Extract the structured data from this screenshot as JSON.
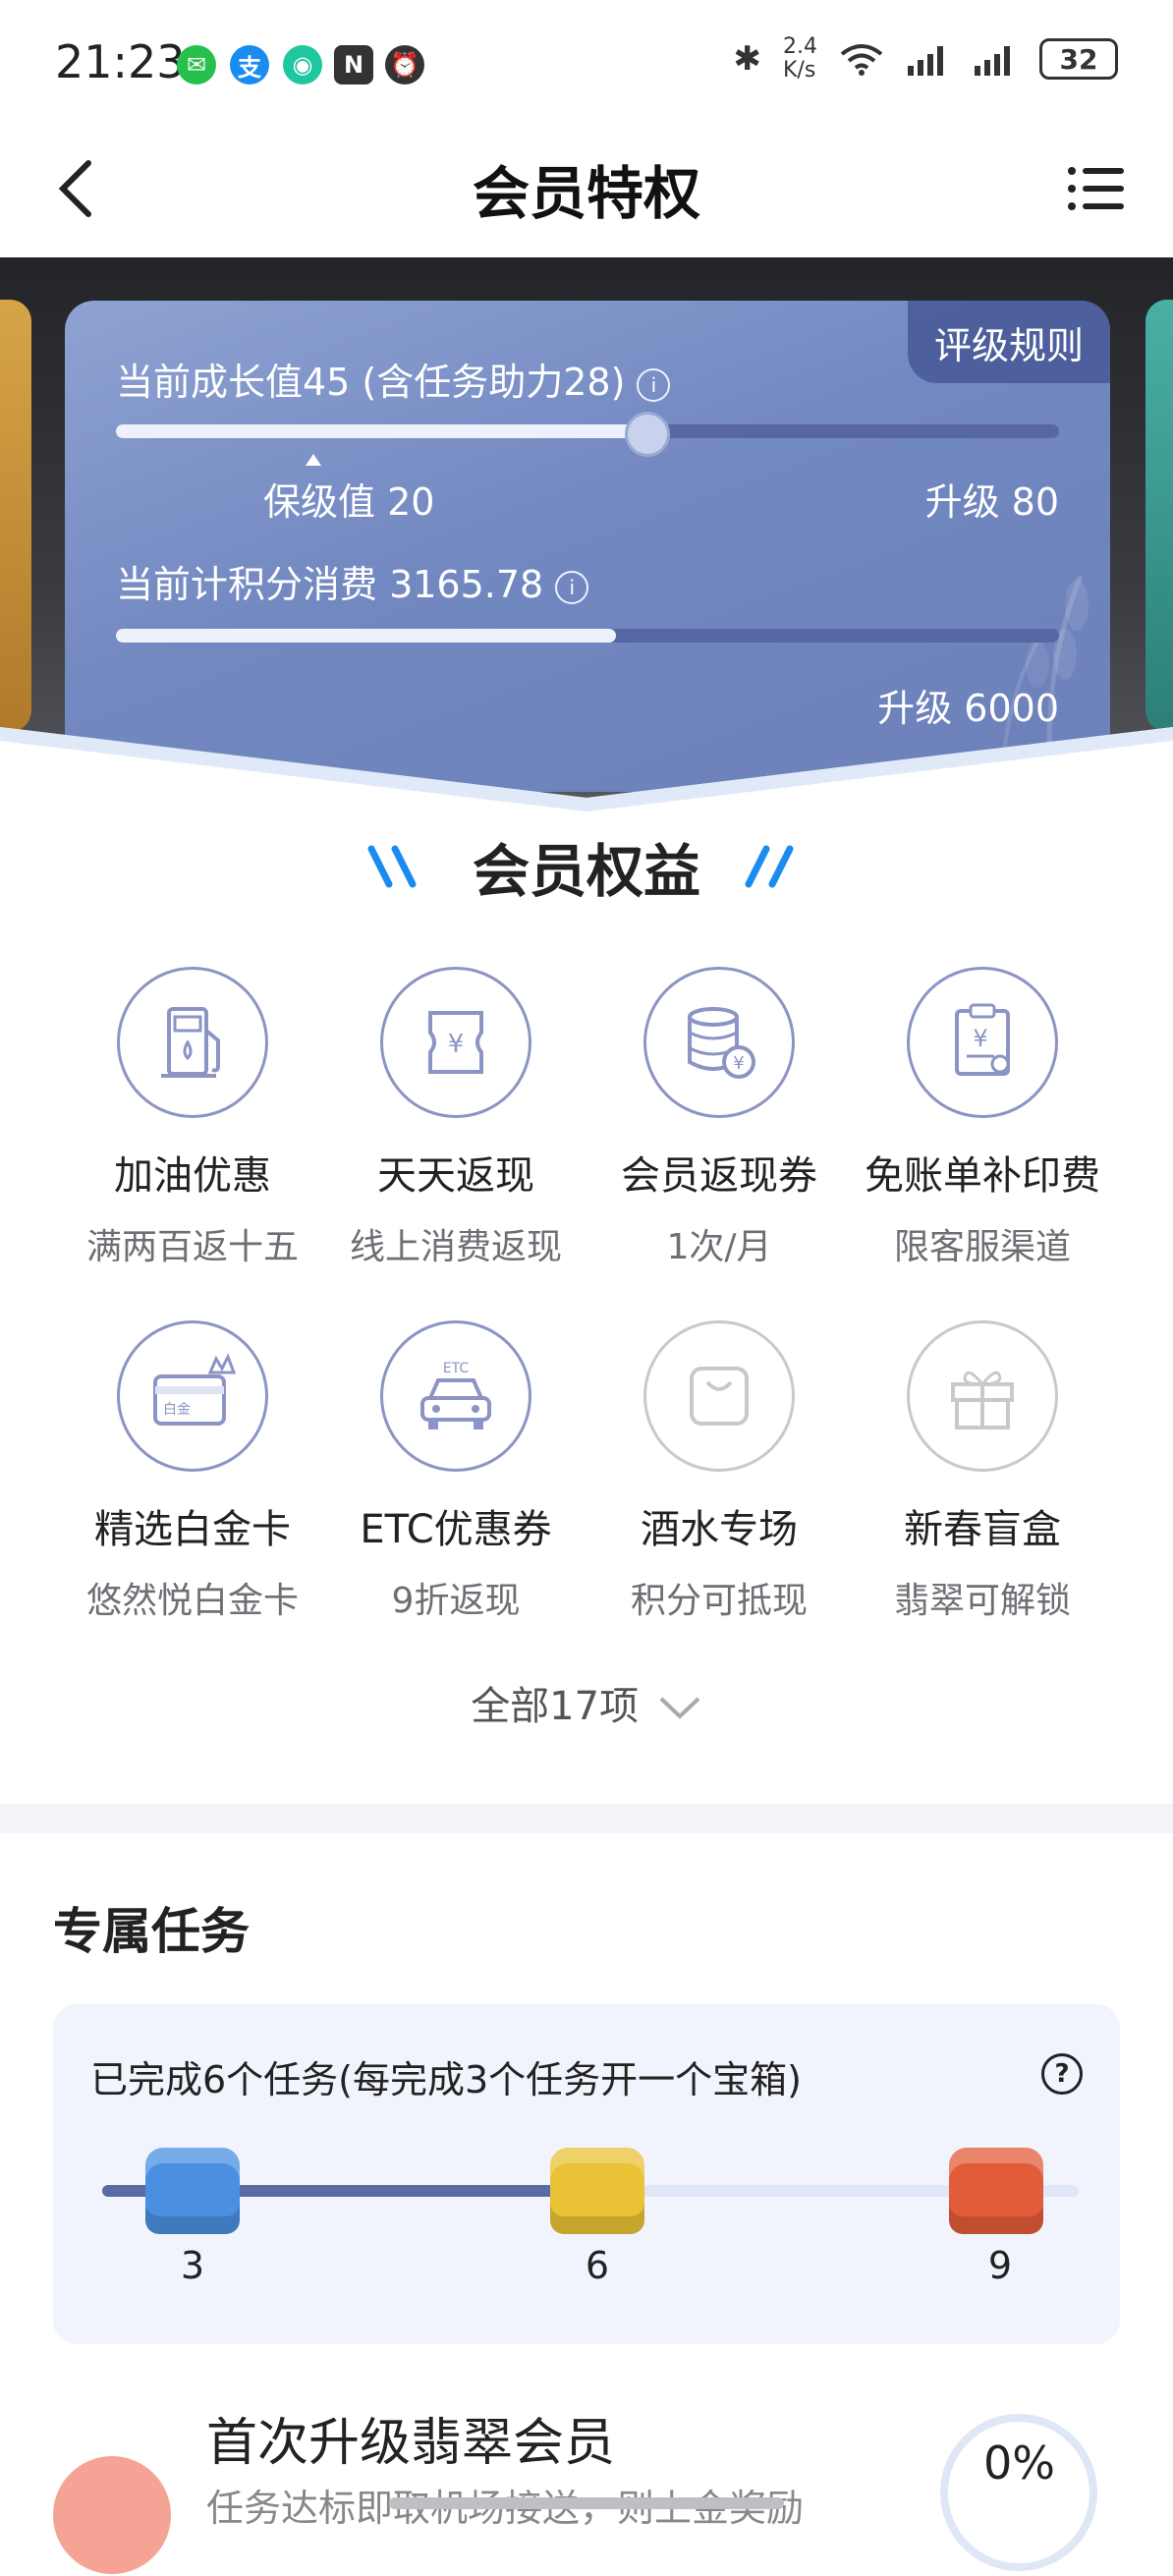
{
  "status_bar": {
    "time": "21:23",
    "net_speed_top": "2.4",
    "net_speed_bottom": "K/s",
    "battery": "32",
    "app_icons": [
      "wechat-icon",
      "alipay-icon",
      "app-icon",
      "nfc-icon",
      "alarm-icon"
    ],
    "system_icons": [
      "bluetooth-icon",
      "wifi-icon",
      "signal-icon",
      "signal-icon"
    ]
  },
  "header": {
    "title": "会员特权"
  },
  "card": {
    "rules_tab": "评级规则",
    "growth_label": "当前成长值45 (含任务助力28)",
    "growth_fraction": 0.56,
    "keep_level": "保级值 20",
    "upgrade_growth": "升级 80",
    "points_label": "当前计积分消费 3165.78",
    "points_fraction": 0.53,
    "upgrade_points": "升级 6000"
  },
  "benefits": {
    "title": "会员权益",
    "items": [
      {
        "name": "加油优惠",
        "desc": "满两百返十五",
        "icon": "fuel-pump-icon"
      },
      {
        "name": "天天返现",
        "desc": "线上消费返现",
        "icon": "yuan-ticket-icon"
      },
      {
        "name": "会员返现券",
        "desc": "1次/月",
        "icon": "coin-stack-icon"
      },
      {
        "name": "免账单补印费",
        "desc": "限客服渠道",
        "icon": "clipboard-yuan-icon"
      },
      {
        "name": "精选白金卡",
        "desc": "悠然悦白金卡",
        "icon": "platinum-card-icon",
        "card_text": "白金"
      },
      {
        "name": "ETC优惠券",
        "desc": "9折返现",
        "icon": "car-icon",
        "badge_text": "ETC"
      },
      {
        "name": "酒水专场",
        "desc": "积分可抵现",
        "icon": "shopping-bag-icon"
      },
      {
        "name": "新春盲盒",
        "desc": "翡翠可解锁",
        "icon": "gift-box-icon"
      }
    ],
    "all_label": "全部17项"
  },
  "tasks": {
    "title": "专属任务",
    "progress_text": "已完成6个任务(每完成3个任务开一个宝箱)",
    "progress_fraction": 0.5,
    "milestones": [
      {
        "label": "3",
        "color": "#4a8fe0"
      },
      {
        "label": "6",
        "color": "#e9c236"
      },
      {
        "label": "9",
        "color": "#e25c3a"
      }
    ]
  },
  "mission": {
    "title": "首次升级翡翠会员",
    "subtitle": "任务达标即取机场接送，则上金奖励",
    "percent": "0%"
  },
  "colors": {
    "card_blue": "#7288c0",
    "icon_stroke": "#8b94c4",
    "progress_fill": "#5a6aa5"
  }
}
